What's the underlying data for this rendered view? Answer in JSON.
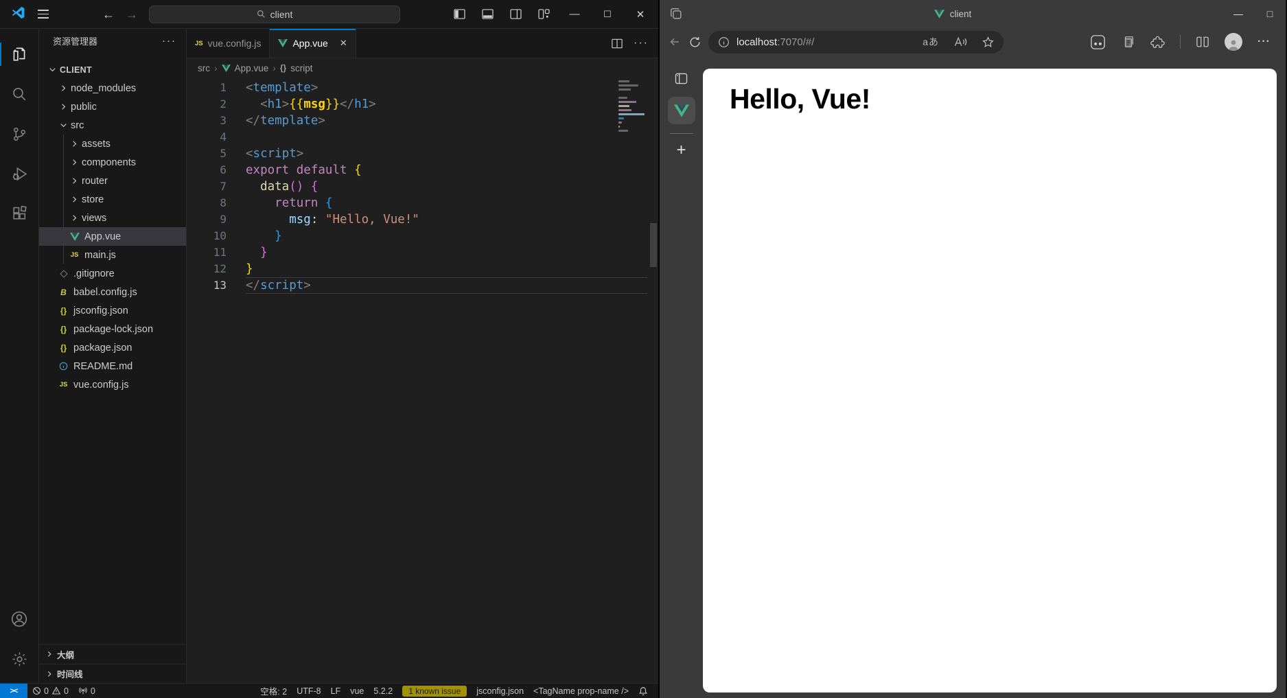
{
  "vscode": {
    "titlebar": {
      "search": "client"
    },
    "activity_bar": {
      "icons": [
        "explorer",
        "search",
        "source-control",
        "run-debug",
        "extensions"
      ],
      "bottom_icons": [
        "account",
        "settings"
      ],
      "active": "explorer"
    },
    "explorer": {
      "title": "资源管理器",
      "actions": "···",
      "root": "CLIENT",
      "tree": [
        {
          "name": "node_modules",
          "icon": "folder",
          "level": 1,
          "chevron": "right"
        },
        {
          "name": "public",
          "icon": "folder",
          "level": 1,
          "chevron": "right"
        },
        {
          "name": "src",
          "icon": "folder",
          "level": 1,
          "chevron": "down"
        },
        {
          "name": "assets",
          "icon": "folder",
          "level": 2,
          "chevron": "right"
        },
        {
          "name": "components",
          "icon": "folder",
          "level": 2,
          "chevron": "right"
        },
        {
          "name": "router",
          "icon": "folder",
          "level": 2,
          "chevron": "right"
        },
        {
          "name": "store",
          "icon": "folder",
          "level": 2,
          "chevron": "right"
        },
        {
          "name": "views",
          "icon": "folder",
          "level": 2,
          "chevron": "right"
        },
        {
          "name": "App.vue",
          "icon": "vue",
          "level": 2,
          "selected": true
        },
        {
          "name": "main.js",
          "icon": "js",
          "level": 2
        },
        {
          "name": ".gitignore",
          "icon": "git",
          "level": 1
        },
        {
          "name": "babel.config.js",
          "icon": "babel",
          "level": 1
        },
        {
          "name": "jsconfig.json",
          "icon": "json",
          "level": 1
        },
        {
          "name": "package-lock.json",
          "icon": "json",
          "level": 1
        },
        {
          "name": "package.json",
          "icon": "json",
          "level": 1
        },
        {
          "name": "README.md",
          "icon": "info",
          "level": 1
        },
        {
          "name": "vue.config.js",
          "icon": "js",
          "level": 1
        }
      ],
      "panels": [
        "大纲",
        "时间线"
      ]
    },
    "tabs": [
      {
        "label": "vue.config.js",
        "icon": "js",
        "active": false
      },
      {
        "label": "App.vue",
        "icon": "vue",
        "active": true
      }
    ],
    "breadcrumb": {
      "folder": "src",
      "file": "App.vue",
      "symbol_icon": "{}",
      "symbol": "script"
    },
    "editor": {
      "active_line": 13,
      "token_colors": {
        "d": "#d4d4d4",
        "p": "#808080",
        "tag": "#569cd6",
        "y": "#ffd700",
        "yb": "#ffd700",
        "kw": "#c586c0",
        "b1": "#ffd700",
        "b2": "#da70d6",
        "b3": "#179fff",
        "fn": "#dcdcaa",
        "prop": "#9cdcfe",
        "str": "#ce9178"
      },
      "lines": [
        [
          [
            "<",
            "p"
          ],
          [
            "template",
            "tag"
          ],
          [
            ">",
            "p"
          ]
        ],
        [
          [
            "  ",
            "d"
          ],
          [
            "<",
            "p"
          ],
          [
            "h1",
            "tag"
          ],
          [
            ">",
            "p"
          ],
          [
            "{{",
            "y"
          ],
          [
            "msg",
            "yb"
          ],
          [
            "}}",
            "y"
          ],
          [
            "</",
            "p"
          ],
          [
            "h1",
            "tag"
          ],
          [
            ">",
            "p"
          ]
        ],
        [
          [
            "</",
            "p"
          ],
          [
            "template",
            "tag"
          ],
          [
            ">",
            "p"
          ]
        ],
        [],
        [
          [
            "<",
            "p"
          ],
          [
            "script",
            "tag"
          ],
          [
            ">",
            "p"
          ]
        ],
        [
          [
            "export",
            "kw"
          ],
          [
            " ",
            "d"
          ],
          [
            "default",
            "kw"
          ],
          [
            " ",
            "d"
          ],
          [
            "{",
            "b1"
          ]
        ],
        [
          [
            "  ",
            "d"
          ],
          [
            "data",
            "fn"
          ],
          [
            "()",
            "b2"
          ],
          [
            " ",
            "d"
          ],
          [
            "{",
            "b2"
          ]
        ],
        [
          [
            "    ",
            "d"
          ],
          [
            "return",
            "kw"
          ],
          [
            " ",
            "d"
          ],
          [
            "{",
            "b3"
          ]
        ],
        [
          [
            "      ",
            "d"
          ],
          [
            "msg",
            "prop"
          ],
          [
            ":",
            "d"
          ],
          [
            " ",
            "d"
          ],
          [
            "\"Hello, Vue!\"",
            "str"
          ]
        ],
        [
          [
            "    ",
            "d"
          ],
          [
            "}",
            "b3"
          ]
        ],
        [
          [
            "  ",
            "d"
          ],
          [
            "}",
            "b2"
          ]
        ],
        [
          [
            "}",
            "b1"
          ]
        ],
        [
          [
            "</",
            "p"
          ],
          [
            "script",
            "tag"
          ],
          [
            ">",
            "p"
          ]
        ]
      ]
    },
    "statusbar": {
      "remote": "><",
      "errors": "0",
      "warnings": "0",
      "ports": "0",
      "spaces": "空格: 2",
      "encoding": "UTF-8",
      "eol": "LF",
      "language": "vue",
      "version": "5.2.2",
      "issue_badge": "1 known issue",
      "task": "jsconfig.json",
      "hint": "<TagName prop-name />"
    }
  },
  "browser": {
    "tab": {
      "title": "client",
      "favicon": "vue-icon"
    },
    "window_controls": {
      "minimize": "—",
      "maximize": "□"
    },
    "toolbar": {
      "url_host": "localhost",
      "url_rest": ":7070/#/",
      "url_icons": [
        "info",
        "translate",
        "read-aloud",
        "favorite"
      ],
      "translate_glyph": "aあ",
      "right_icons": [
        "browser-essentials",
        "collections",
        "extensions",
        "split-screen",
        "profile",
        "more"
      ],
      "more_glyph": "···"
    },
    "sidebar": {
      "icons": [
        "sidebar-toggle",
        "vue-devtools",
        "add"
      ],
      "plus_glyph": "+"
    },
    "page": {
      "heading": "Hello, Vue!"
    }
  },
  "colors": {
    "accent_blue": "#0078d4",
    "vue_green": "#41b883",
    "vue_dark": "#35495e",
    "editor_bg": "#1f1f1f",
    "chrome_bg": "#181818",
    "edge_bg": "#3a3a3a",
    "badge_bg": "#a39200"
  }
}
